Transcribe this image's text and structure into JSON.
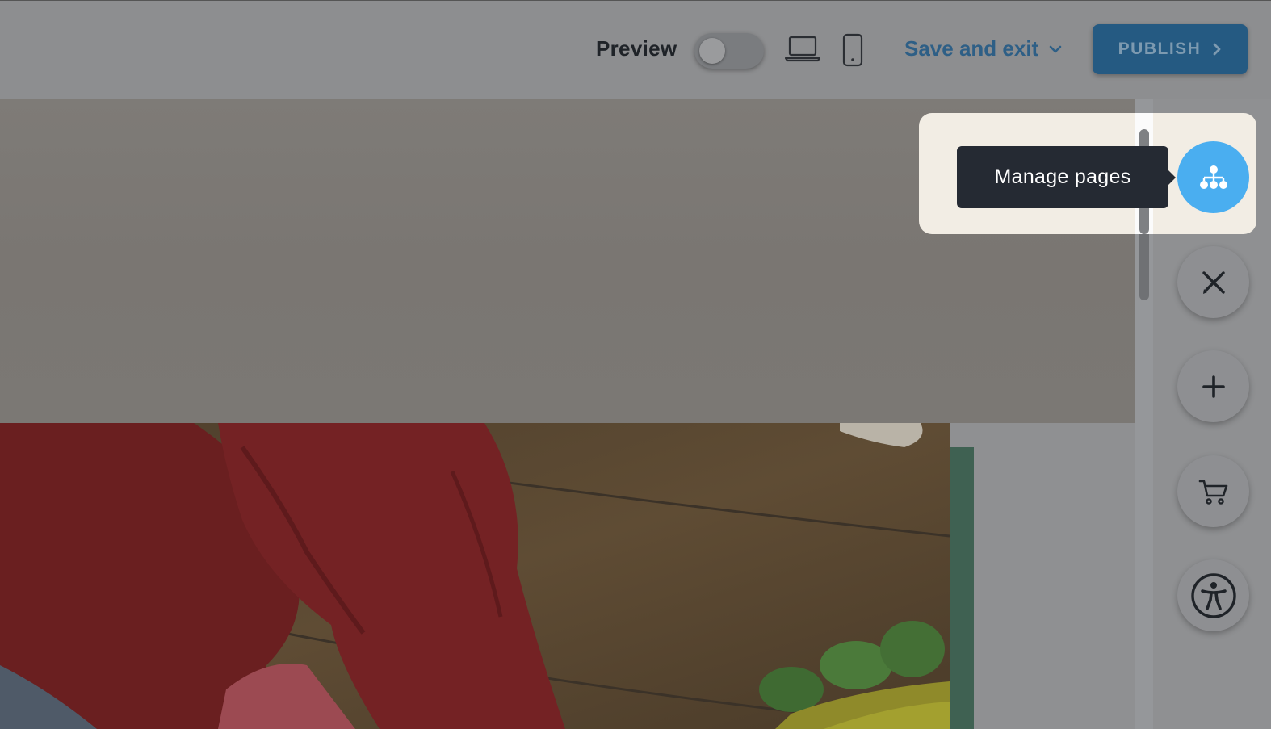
{
  "toolbar": {
    "preview_label": "Preview",
    "preview_toggle_on": false,
    "save_exit_label": "Save and exit",
    "publish_label": "PUBLISH"
  },
  "rail": {
    "tooltip": "Manage pages",
    "buttons": [
      {
        "name": "manage-pages",
        "icon": "sitemap-icon",
        "active": true
      },
      {
        "name": "design-tools",
        "icon": "tools-icon",
        "active": false
      },
      {
        "name": "add-section",
        "icon": "plus-icon",
        "active": false
      },
      {
        "name": "store",
        "icon": "cart-icon",
        "active": false
      },
      {
        "name": "accessibility",
        "icon": "accessibility-icon",
        "active": false
      }
    ]
  },
  "colors": {
    "accent": "#4aaef0",
    "publish": "#255a82",
    "tooltip_bg": "#252a33",
    "green_strip": "#3f6152"
  }
}
